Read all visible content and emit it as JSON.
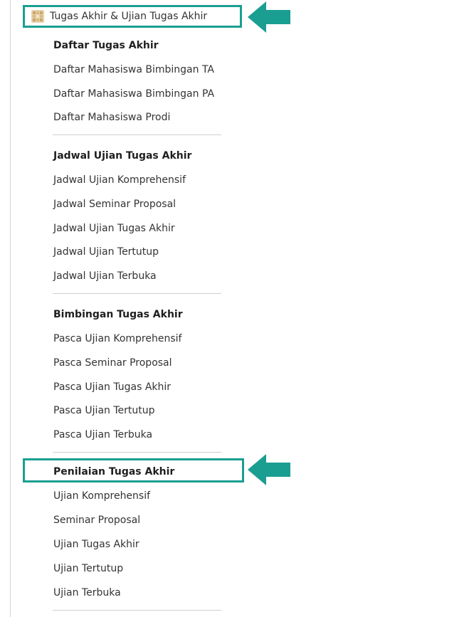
{
  "header": {
    "title": "Tugas Akhir & Ujian Tugas Akhir",
    "icon": "app-grid-icon"
  },
  "sections": [
    {
      "heading": "Daftar Tugas Akhir",
      "items": [
        "Daftar Mahasiswa Bimbingan TA",
        "Daftar Mahasiswa Bimbingan PA",
        "Daftar Mahasiswa Prodi"
      ]
    },
    {
      "heading": "Jadwal Ujian Tugas Akhir",
      "items": [
        "Jadwal Ujian Komprehensif",
        "Jadwal Seminar Proposal",
        "Jadwal Ujian Tugas Akhir",
        "Jadwal Ujian Tertutup",
        "Jadwal Ujian Terbuka"
      ]
    },
    {
      "heading": "Bimbingan Tugas Akhir",
      "items": [
        "Pasca Ujian Komprehensif",
        "Pasca Seminar Proposal",
        "Pasca Ujian Tugas Akhir",
        "Pasca Ujian Tertutup",
        "Pasca Ujian Terbuka"
      ]
    },
    {
      "heading": "Penilaian Tugas Akhir",
      "items": [
        "Ujian Komprehensif",
        "Seminar Proposal",
        "Ujian Tugas Akhir",
        "Ujian Tertutup",
        "Ujian Terbuka"
      ]
    }
  ],
  "colors": {
    "highlight": "#1a9e92",
    "icon": "#d9b98a"
  }
}
